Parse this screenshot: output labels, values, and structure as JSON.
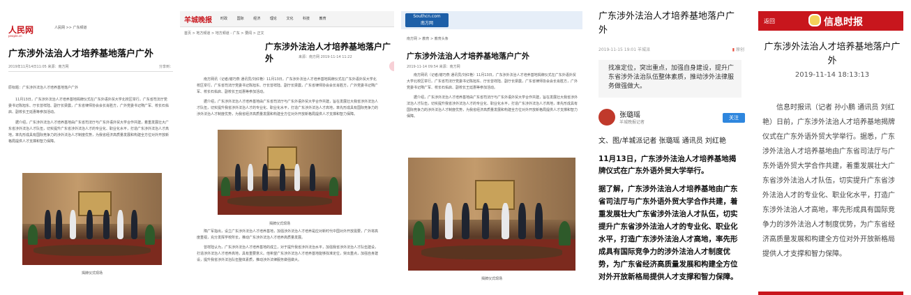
{
  "panel1": {
    "logo": "人民网",
    "logo_sub": "people.cn",
    "nav": "人民网 >> 广东频道",
    "title": "广东涉外法治人才培养基地落户广外",
    "date_source": "2019年11月14日11:05 来源：南方网",
    "share": "分享到：",
    "origin": "原标题：广东涉外法治人才培养基地落户广外",
    "para1": "11月13日，广东涉外法治人才培养基地揭牌仪式在广东外语外贸大学北校区举行。广东省司法厅党委书记陈旭东、厅长曾祥陆、副厅长梁震，广东省律师协会会长肖胜方，广外党委书记隋广军、校长石佑启、副校长王廷惠等参加活动。",
    "para2": "据介绍，广东涉外法治人才培养基地由广东省司法厅与广东外语外贸大学合作共建，着重发展壮大广东省涉外法治人才队伍，切实提升广东省涉外法治人才的专业化、职业化水平，打造广东涉外法治人才高地，率先形成具有国际竞争力的涉外法治人才制度优势，为我省经济高质量发展和构建全方位对外开放新格局提供人才支撑和智力保障。",
    "caption": "揭牌仪式现场"
  },
  "panel2": {
    "logo": "羊城晚报",
    "nav": [
      "时政",
      "国际",
      "经济",
      "理论",
      "文化",
      "科技",
      "教育"
    ],
    "crumb": "首页 > 地方频道 > 地方频道 - 广东 > 要闻 > 正文",
    "title": "广东涉外法治人才培养基地落户广外",
    "meta": "来源：南方网   2019-11-14 11:22",
    "para1": "南方网讯（记者/谢巧燕 通讯员/刘红艳）11月13日，广东涉外法治人才培养基地揭牌仪式在广东外语外贸大学北校区举行。广东省司法厅党委书记陈旭东、厅长曾祥陆、副厅长梁震，广东省律师协会会长肖胜方，广外党委书记隋广军、校长石佑启、副校长王廷惠等参加活动。",
    "para2": "据介绍，广东涉外法治人才培养基地由广东省司法厅与广东外语外贸大学合作共建，旨在发展壮大我省涉外法治人才队伍，切实提升我省涉外法治人才的专业化、职业化水平，打造广东涉外法治人才高地，率先形成具有国际竞争力的涉外法治人才制度优势，为我省经济高质量发展和构建全方位对外开放新格局提供人才支撑和智力保障。",
    "caption": "揭牌仪式现场",
    "para3": "隋广军指出，设立广东涉外法治人才培养基地，加强涉外法治人才培养是应对新时代中国对外开放需要，广外将高度重视，充分发挥学校所长，推动广东涉外法治人才培养高质量发展。",
    "para4": "曾祥陆认为，广东涉外法治人才培养基地的成立，对于提升我省涉外法治水平，加强我省涉外法治人才队伍建设，打造涉外法治人才培养高地，具有重要意义。他希望广东涉外法治人才培养基地能够找准定位，突出重点，加强自身建设，提升我省涉外法治队伍整体素质，推动涉外法律服务做强做大。"
  },
  "panel3": {
    "logo": "Southcn.com",
    "logo_sub": "南方网",
    "crumb": "南方网 > 教育 > 教育头条",
    "title": "广东涉外法治人才培养基地落户广外",
    "meta": "2019-11-14 09:54   来源：南方网",
    "para1": "南方网讯（记者/谢巧燕 通讯员/刘红艳）11月13日，广东涉外法治人才培养基地揭牌仪式在广东外语外贸大学北校区举行。广东省司法厅党委书记陈旭东、厅长曾祥陆、副厅长梁震，广东省律师协会会长肖胜方，广外党委书记隋广军、校长石佑启、副校长王廷惠等参加活动。",
    "para2": "据介绍，广东涉外法治人才培养基地由广东省司法厅与广东外语外贸大学合作共建，旨在发展壮大我省涉外法治人才队伍，切实提升我省涉外法治人才的专业化、职业化水平，打造广东涉外法治人才高地，率先形成具有国际竞争力的涉外法治人才制度优势，为我省经济高质量发展和构建全方位对外开放新格局提供人才支撑和智力保障。",
    "caption": "揭牌仪式现场"
  },
  "panel4": {
    "title": "广东涉外法治人才培养基地落户广外",
    "meta": "2019-11-15 19:01  羊城派",
    "origin": "原创",
    "summary": "找准定位，突出重点，加强自身建设，提升广东省涉外法治队伍整体素质，推动涉外法律服务做强做大。",
    "author": "张璐瑶",
    "author_sub": "羊城晚报记者",
    "follow": "关注",
    "byline": "文、图/羊城派记者 张璐瑶 通讯员 刘红艳",
    "lead": "11月13日，广东涉外法治人才培养基地揭牌仪式在广东外语外贸大学举行。",
    "body": "据了解，广东涉外法治人才培养基地由广东省司法厅与广东外语外贸大学合作共建，着重发展壮大广东省涉外法治人才队伍，切实提升广东省涉外法治人才的专业化、职业化水平，打造广东涉外法治人才高地，率先形成具有国际竞争力的涉外法治人才制度优势，为广东省经济高质量发展和构建全方位对外开放新格局提供人才支撑和智力保障。"
  },
  "panel5": {
    "back": "返回",
    "brand": "信息时报",
    "title": "广东涉外法治人才培养基地落户广外",
    "date": "2019-11-14 18:13:13",
    "body": "信息时报讯（记者 孙小鹏 通讯员 刘红艳）日前，广东涉外法治人才培养基地揭牌仪式在广东外语外贸大学举行。据悉，广东涉外法治人才培养基地由广东省司法厅与广东外语外贸大学合作共建，着重发展壮大广东省涉外法治人才队伍，切实提升广东省涉外法治人才的专业化、职业化水平，打造广东涉外法治人才高地，率先形成具有国际竞争力的涉外法治人才制度优势，为广东省经济高质量发展和构建全方位对外开放新格局提供人才支撑和智力保障。"
  },
  "colors": {
    "brand_red": "#c8161d",
    "nanfang_blue": "#1d5fa8",
    "follow_blue": "#2e86de"
  }
}
